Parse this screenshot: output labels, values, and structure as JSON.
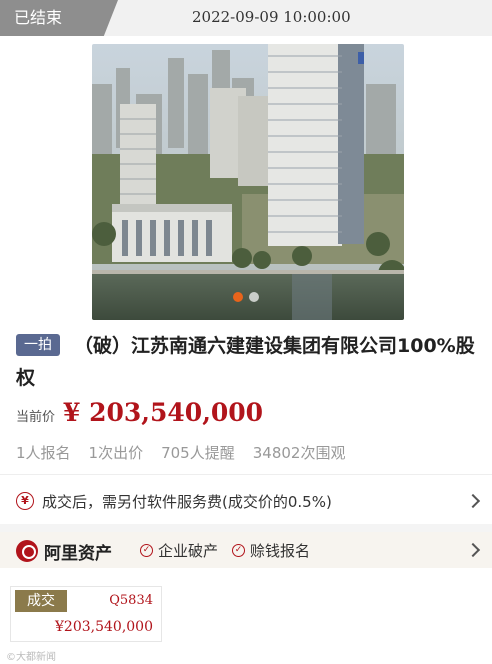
{
  "status": {
    "ended_label": "已结束",
    "end_time": "2022-09-09 10:00:00"
  },
  "carousel": {
    "total": 2,
    "active": 1
  },
  "listing": {
    "round_badge": "一拍",
    "title": "（破）江苏南通六建建设集团有限公司100%股权",
    "price_label": "当前价",
    "price": "¥ 203,540,000"
  },
  "stats": [
    "1人报名",
    "1次出价",
    "705人提醒",
    "34802次围观"
  ],
  "fee_notice": "成交后，需另付软件服务费(成交价的0.5%)",
  "platform": {
    "name": "阿里资产",
    "tags": [
      "企业破产",
      "赊钱报名"
    ]
  },
  "deal_card": {
    "tag": "成交",
    "code": "Q5834",
    "price": "¥203,540,000"
  },
  "watermark": "©大都新闻",
  "colors": {
    "accent_red": "#b1141b",
    "badge_blue": "#5a6991",
    "deal_gold": "#8b7a4b"
  }
}
